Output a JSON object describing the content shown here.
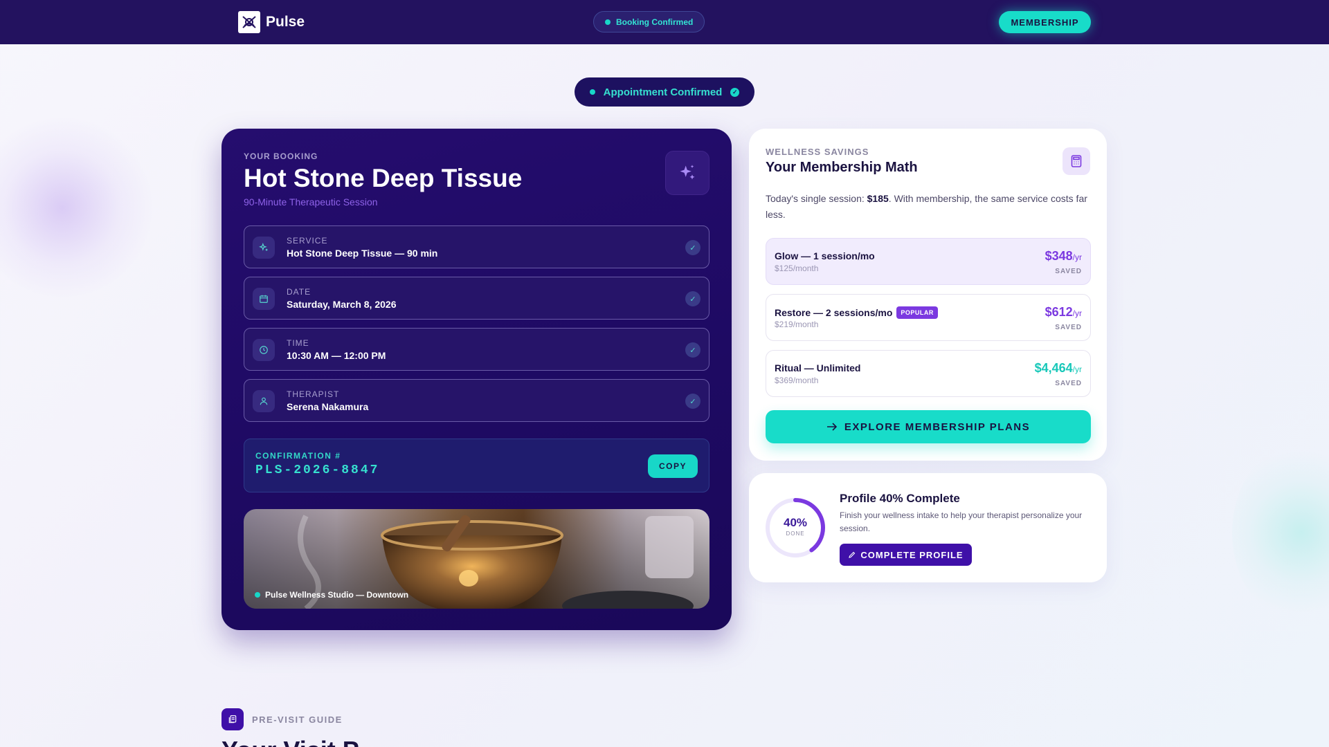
{
  "nav": {
    "brand": "Pulse",
    "status": "Booking Confirmed",
    "cta": "MEMBERSHIP"
  },
  "confirm_pill": "Appointment Confirmed",
  "booking": {
    "eyebrow": "YOUR BOOKING",
    "title": "Hot Stone Deep Tissue",
    "subtitle": "90-Minute Therapeutic Session",
    "details": [
      {
        "label": "SERVICE",
        "value": "Hot Stone Deep Tissue — 90 min",
        "icon": "sparkle-icon"
      },
      {
        "label": "DATE",
        "value": "Saturday, March 8, 2026",
        "icon": "calendar-icon"
      },
      {
        "label": "TIME",
        "value": "10:30 AM — 12:00 PM",
        "icon": "clock-icon"
      },
      {
        "label": "THERAPIST",
        "value": "Serena Nakamura",
        "icon": "user-icon"
      }
    ],
    "confirmation_label": "CONFIRMATION #",
    "confirmation_number": "PLS-2026-8847",
    "copy_label": "COPY",
    "location": "Pulse Wellness Studio — Downtown"
  },
  "savings": {
    "eyebrow": "WELLNESS SAVINGS",
    "title": "Your Membership Math",
    "text_prefix": "Today's single session: ",
    "text_price": "$185",
    "text_suffix": ". With membership, the same service costs far less.",
    "plans": [
      {
        "name": "Glow — 1 session/mo",
        "monthly": "$125/month",
        "amount": "$348",
        "per": "/yr",
        "saved": "SAVED",
        "badge": ""
      },
      {
        "name": "Restore — 2 sessions/mo",
        "monthly": "$219/month",
        "amount": "$612",
        "per": "/yr",
        "saved": "SAVED",
        "badge": "POPULAR"
      },
      {
        "name": "Ritual — Unlimited",
        "monthly": "$369/month",
        "amount": "$4,464",
        "per": "/yr",
        "saved": "SAVED",
        "badge": ""
      }
    ],
    "cta": "EXPLORE MEMBERSHIP PLANS"
  },
  "profile": {
    "percent": 40,
    "percent_label": "40%",
    "done_label": "DONE",
    "title": "Profile 40% Complete",
    "text": "Finish your wellness intake to help your therapist personalize your session.",
    "cta": "COMPLETE PROFILE"
  },
  "guide": {
    "eyebrow": "PRE-VISIT GUIDE",
    "title": "Your Visit P"
  },
  "colors": {
    "nav_bg": "#23125f",
    "accent_teal": "#18dcc9",
    "accent_purple": "#7b39e0",
    "card_dark": "#1e0a63"
  }
}
